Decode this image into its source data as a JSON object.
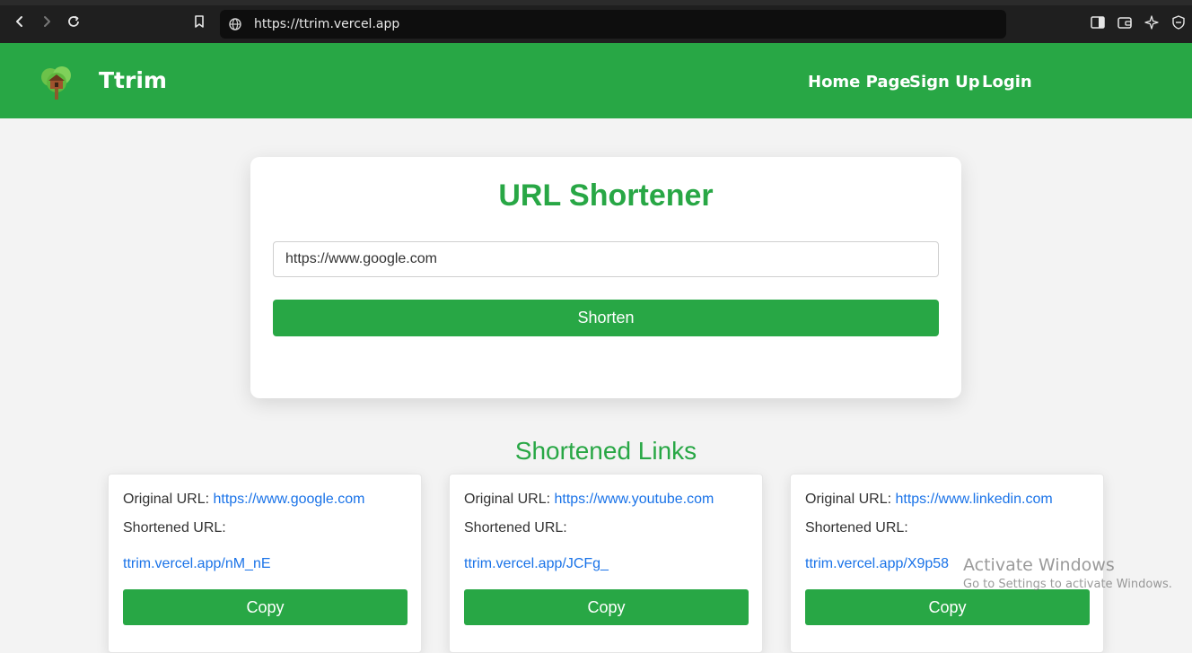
{
  "browser": {
    "url": "https://ttrim.vercel.app"
  },
  "header": {
    "brand": "Ttrim",
    "nav": [
      "Home Page",
      "Sign Up",
      "Login"
    ],
    "bg_color": "#28a745"
  },
  "shortener": {
    "title": "URL Shortener",
    "input_value": "https://www.google.com",
    "button_label": "Shorten"
  },
  "links_section": {
    "title": "Shortened Links",
    "original_label": "Original URL:",
    "shortened_label": "Shortened URL:",
    "copy_label": "Copy",
    "items": [
      {
        "original": "https://www.google.com",
        "short": "ttrim.vercel.app/nM_nE"
      },
      {
        "original": "https://www.youtube.com",
        "short": "ttrim.vercel.app/JCFg_"
      },
      {
        "original": "https://www.linkedin.com",
        "short": "ttrim.vercel.app/X9p58"
      }
    ]
  },
  "watermark": {
    "title": "Activate Windows",
    "subtitle": "Go to Settings to activate Windows."
  }
}
